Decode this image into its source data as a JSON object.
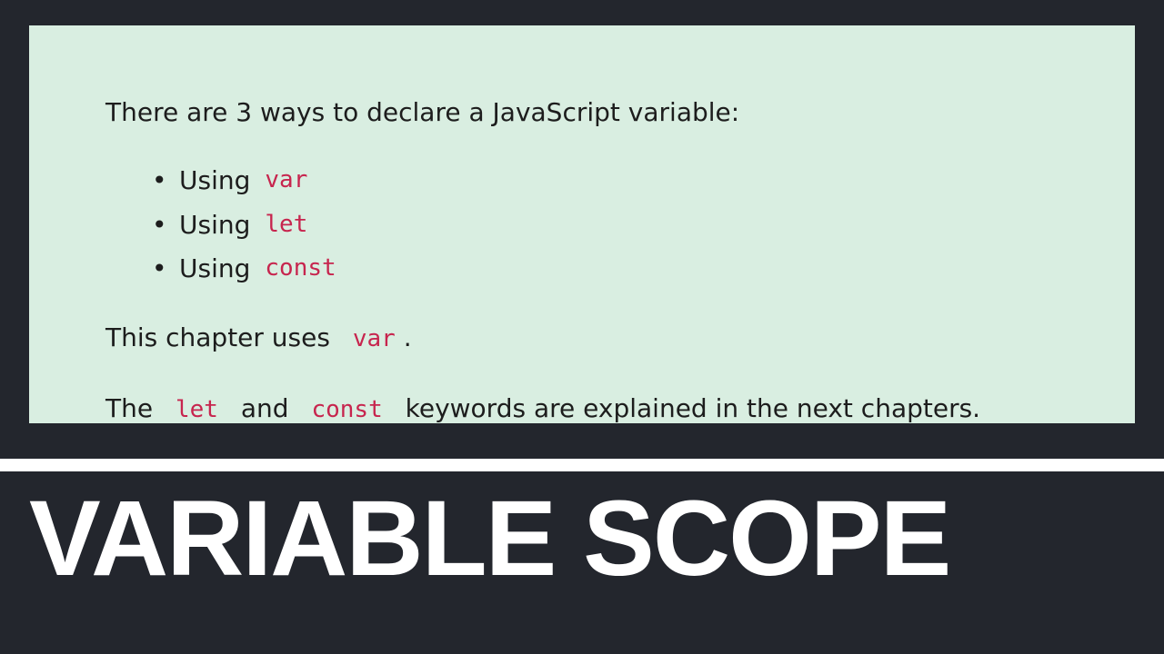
{
  "note": {
    "intro": "There are 3 ways to declare a JavaScript variable:",
    "bullets": [
      {
        "prefix": "Using",
        "keyword": "var"
      },
      {
        "prefix": "Using",
        "keyword": "let"
      },
      {
        "prefix": "Using",
        "keyword": "const"
      }
    ],
    "chapter_sentence": {
      "before": "This chapter uses",
      "keyword": "var",
      "after": "."
    },
    "explanation_sentence": {
      "before": "The",
      "keyword1": "let",
      "middle": "and",
      "keyword2": "const",
      "after": "keywords are explained in the next chapters."
    }
  },
  "footer": {
    "title": "VARIABLE SCOPE"
  },
  "colors": {
    "background": "#23262d",
    "note_box": "#d9eee1",
    "keyword": "#c7254e",
    "text": "#1d1d1d",
    "title": "#ffffff"
  }
}
